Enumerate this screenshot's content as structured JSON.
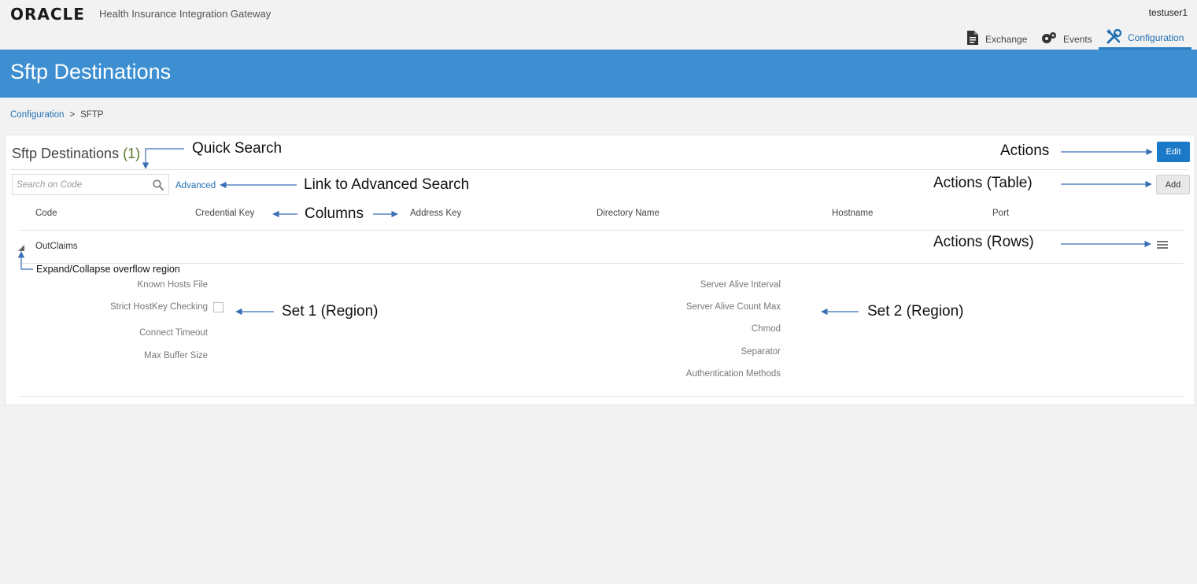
{
  "header": {
    "logo": "ORACLE",
    "app_title": "Health Insurance Integration Gateway",
    "user": "testuser1",
    "nav": [
      {
        "label": "Exchange",
        "icon": "document-icon"
      },
      {
        "label": "Events",
        "icon": "events-icon"
      },
      {
        "label": "Configuration",
        "icon": "tools-icon",
        "active": true
      }
    ]
  },
  "banner": {
    "title": "Sftp Destinations"
  },
  "breadcrumb": {
    "parent": "Configuration",
    "separator": ">",
    "current": "SFTP"
  },
  "panel": {
    "title": "Sftp Destinations",
    "count": "(1)",
    "edit_label": "Edit",
    "add_label": "Add",
    "search_placeholder": "Search on Code",
    "advanced_label": "Advanced"
  },
  "table": {
    "columns": [
      "Code",
      "Credential Key",
      "Address Key",
      "Directory Name",
      "Hostname",
      "Port"
    ],
    "rows": [
      {
        "code": "OutClaims"
      }
    ]
  },
  "detail": {
    "set1": [
      "Known Hosts File",
      "Strict HostKey Checking",
      "Connect Timeout",
      "Max Buffer Size"
    ],
    "set2": [
      "Server Alive Interval",
      "Server Alive Count Max",
      "Chmod",
      "Separator",
      "Authentication Methods"
    ]
  },
  "annotations": {
    "quick_search": "Quick Search",
    "actions": "Actions",
    "link_adv": "Link to Advanced Search",
    "actions_table": "Actions (Table)",
    "columns": "Columns",
    "actions_rows": "Actions (Rows)",
    "expand_collapse": "Expand/Collapse overflow region",
    "set1": "Set 1 (Region)",
    "set2": "Set 2 (Region)"
  },
  "colors": {
    "banner": "#3d8fd1",
    "primary_button": "#1a7ac8",
    "link": "#1f6fb3",
    "arrow": "#3a6fb5"
  }
}
